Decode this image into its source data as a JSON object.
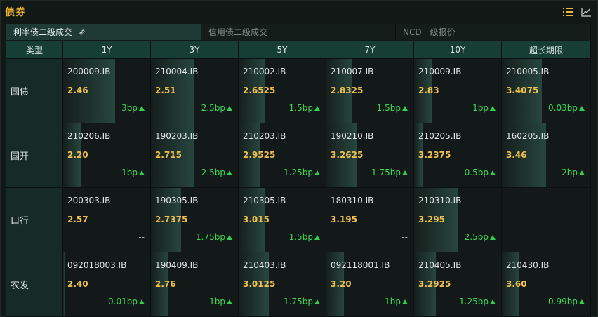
{
  "header": {
    "title": "债券",
    "icons": [
      "list-icon",
      "line-chart-icon"
    ]
  },
  "tabs": [
    {
      "label": "利率债二级成交",
      "active": true,
      "icon": "link-icon"
    },
    {
      "label": "信用债二级成交",
      "active": false
    },
    {
      "label": "NCD一级报价",
      "active": false
    }
  ],
  "columns": [
    "类型",
    "1Y",
    "3Y",
    "5Y",
    "7Y",
    "10Y",
    "超长期限"
  ],
  "rows": [
    {
      "type": "国债",
      "cells": [
        {
          "code": "200009.IB",
          "yield": "2.46",
          "change": "3bp",
          "up": true,
          "level": 0.6
        },
        {
          "code": "210004.IB",
          "yield": "2.51",
          "change": "2.5bp",
          "up": true,
          "level": 0.5
        },
        {
          "code": "210002.IB",
          "yield": "2.6525",
          "change": "1.5bp",
          "up": true,
          "level": 0.3
        },
        {
          "code": "210007.IB",
          "yield": "2.8325",
          "change": "1.5bp",
          "up": true,
          "level": 0.3
        },
        {
          "code": "210009.IB",
          "yield": "2.83",
          "change": "1bp",
          "up": true,
          "level": 0.2
        },
        {
          "code": "210005.IB",
          "yield": "3.4075",
          "change": "0.03bp",
          "up": true,
          "level": 0.45
        }
      ]
    },
    {
      "type": "国开",
      "cells": [
        {
          "code": "210206.IB",
          "yield": "2.20",
          "change": "1bp",
          "up": true,
          "level": 0.2
        },
        {
          "code": "190203.IB",
          "yield": "2.715",
          "change": "2.5bp",
          "up": true,
          "level": 0.5
        },
        {
          "code": "210203.IB",
          "yield": "2.9525",
          "change": "1.25bp",
          "up": true,
          "level": 0.25
        },
        {
          "code": "190210.IB",
          "yield": "3.2625",
          "change": "1.75bp",
          "up": true,
          "level": 0.35
        },
        {
          "code": "210205.IB",
          "yield": "3.2375",
          "change": "0.5bp",
          "up": true,
          "level": 0.1
        },
        {
          "code": "160205.IB",
          "yield": "3.46",
          "change": "2bp",
          "up": true,
          "level": 0.5
        }
      ]
    },
    {
      "type": "口行",
      "cells": [
        {
          "code": "200303.IB",
          "yield": "2.57",
          "change": "--",
          "up": false,
          "level": 0
        },
        {
          "code": "190305.IB",
          "yield": "2.7375",
          "change": "1.75bp",
          "up": true,
          "level": 0.35
        },
        {
          "code": "210305.IB",
          "yield": "3.015",
          "change": "1.5bp",
          "up": true,
          "level": 0.3
        },
        {
          "code": "180310.IB",
          "yield": "3.195",
          "change": "--",
          "up": false,
          "level": 0
        },
        {
          "code": "210310.IB",
          "yield": "3.295",
          "change": "2.5bp",
          "up": true,
          "level": 0.5
        },
        {
          "code": "",
          "yield": "",
          "change": "",
          "up": false,
          "level": 0
        }
      ]
    },
    {
      "type": "农发",
      "cells": [
        {
          "code": "092018003.IB",
          "yield": "2.40",
          "change": "0.01bp",
          "up": true,
          "level": 0.02
        },
        {
          "code": "190409.IB",
          "yield": "2.76",
          "change": "1bp",
          "up": true,
          "level": 0.2
        },
        {
          "code": "210403.IB",
          "yield": "3.0125",
          "change": "1.75bp",
          "up": true,
          "level": 0.35
        },
        {
          "code": "092118001.IB",
          "yield": "3.20",
          "change": "1bp",
          "up": true,
          "level": 0.2
        },
        {
          "code": "210405.IB",
          "yield": "3.2925",
          "change": "1.25bp",
          "up": true,
          "level": 0.25
        },
        {
          "code": "210430.IB",
          "yield": "3.60",
          "change": "0.99bp",
          "up": true,
          "level": 0.2
        }
      ]
    }
  ],
  "colors": {
    "title": "#f1b73a",
    "yield": "#f2c04d",
    "up": "#3fd655",
    "header_bg": "#173e35",
    "active_tab_bg": "#1f3a35"
  }
}
